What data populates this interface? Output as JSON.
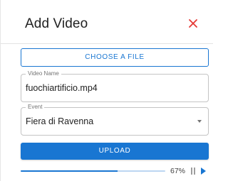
{
  "dialog": {
    "title": "Add Video",
    "close_icon": "close-icon",
    "close_color": "#e53935"
  },
  "choose_file": {
    "label": "CHOOSE A FILE"
  },
  "video_name": {
    "label": "Video Name",
    "value": "fuochiartificio.mp4"
  },
  "event": {
    "label": "Event",
    "value": "Fiera di Ravenna",
    "icon": "chevron-down-icon"
  },
  "upload": {
    "label": "UPLOAD"
  },
  "progress": {
    "percent": 67,
    "text": "67%",
    "pause_icon": "pause-icon",
    "play_icon": "play-icon"
  },
  "colors": {
    "primary": "#1976d2",
    "progress_track": "#bcd6f2",
    "close": "#e53935"
  }
}
